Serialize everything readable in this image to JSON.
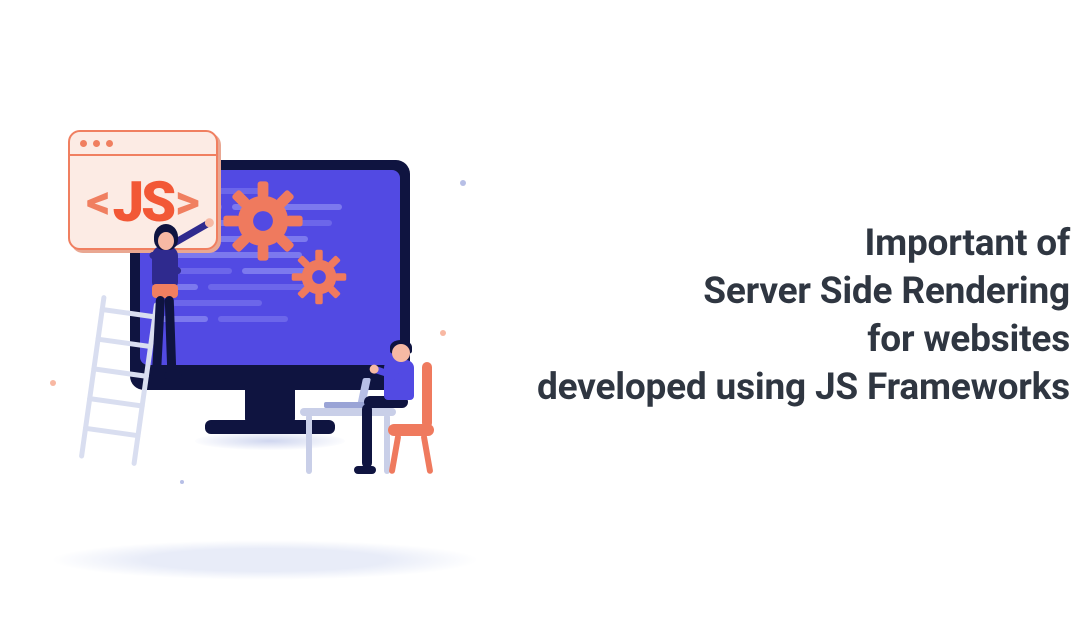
{
  "headline": {
    "line1": "Important of",
    "line2": "Server Side Rendering",
    "line3": "for websites",
    "line4": "developed using JS Frameworks"
  },
  "badge": {
    "left_angle": "<",
    "text": "JS",
    "right_angle": ">"
  },
  "colors": {
    "headline": "#2f3641",
    "monitor_bezel": "#0f1440",
    "screen": "#524ae3",
    "code_line_a": "#7c79ee",
    "code_line_b": "#6c66ea",
    "accent_orange": "#f07f60",
    "accent_orange_dark": "#f25836",
    "badge_bg": "#fcebe4",
    "pale_blue": "#d9def0",
    "desk_gray": "#c9cfe8",
    "skin": "#f6b9a4",
    "shirt_navy": "#2f2a8e",
    "shadow": "#e8ecf8"
  }
}
